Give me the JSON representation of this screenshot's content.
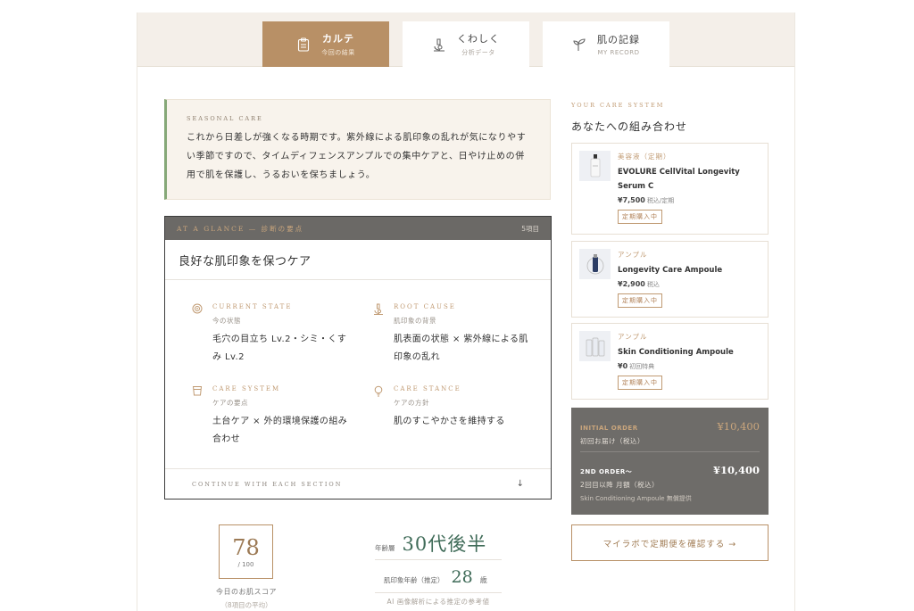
{
  "tabs": [
    {
      "main": "カルテ",
      "sub": "今回の結果",
      "icon": "clipboard-icon"
    },
    {
      "main": "くわしく",
      "sub": "分析データ",
      "icon": "microscope-icon"
    },
    {
      "main": "肌の記録",
      "sub": "MY RECORD",
      "icon": "sprout-icon"
    }
  ],
  "seasonal": {
    "label": "SEASONAL CARE",
    "body": "これから日差しが強くなる時期です。紫外線による肌印象の乱れが気になりやすい季節ですので、タイムディフェンスアンプルでの集中ケアと、日やけ止めの併用で肌を保護し、うるおいを保ちましょう。"
  },
  "glance": {
    "header": "AT A GLANCE — 診断の要点",
    "count": "5項目",
    "title": "良好な肌印象を保つケア",
    "cells": [
      {
        "head": "CURRENT STATE",
        "sub": "今の状態",
        "body": "毛穴の目立ち Lv.2・シミ・くすみ Lv.2",
        "icon": "target-icon"
      },
      {
        "head": "ROOT CAUSE",
        "sub": "肌印象の背景",
        "body": "肌表面の状態 × 紫外線による肌印象の乱れ",
        "icon": "microscope-icon"
      },
      {
        "head": "CARE SYSTEM",
        "sub": "ケアの要点",
        "body": "土台ケア × 外的環境保護の組み合わせ",
        "icon": "cup-icon"
      },
      {
        "head": "CARE STANCE",
        "sub": "ケアの方針",
        "body": "肌のすこやかさを維持する",
        "icon": "bulb-icon"
      }
    ],
    "footer": "CONTINUE WITH EACH SECTION",
    "footer_arrow": "↓"
  },
  "score": {
    "value": "78",
    "denominator": "/ 100",
    "label": "今日のお肌スコア",
    "note": "（8項目の平均）"
  },
  "age": {
    "label": "年齢層",
    "value": "30代後半",
    "est_label": "肌印象年齢（推定）",
    "est_value": "28",
    "est_unit": "歳",
    "note": "AI 画像解析による推定の参考値"
  },
  "care_system": {
    "label": "YOUR CARE SYSTEM",
    "title": "あなたへの組み合わせ",
    "products": [
      {
        "category": "美容液（定期）",
        "name": "EVOLURE CellVital Longevity Serum C",
        "price": "¥7,500",
        "tax": "税込/定期",
        "badge": "定期購入中"
      },
      {
        "category": "アンプル",
        "name": "Longevity Care Ampoule",
        "price": "¥2,900",
        "tax": "税込",
        "badge": "定期購入中"
      },
      {
        "category": "アンプル",
        "name": "Skin Conditioning Ampoule",
        "price": "¥0",
        "tax": "初回特典",
        "badge": "定期購入中"
      }
    ]
  },
  "orders": {
    "initial_label": "INITIAL ORDER",
    "initial_price": "¥10,400",
    "initial_sub": "初回お届け（税込）",
    "second_label": "2ND ORDER〜",
    "second_price": "¥10,400",
    "second_sub": "2回目以降 月額（税込）",
    "second_note": "Skin Conditioning Ampoule 無償提供"
  },
  "cta": {
    "label": "マイラボで定期便を確認する →"
  },
  "colors": {
    "accent": "#b89066",
    "green": "#3f6b58",
    "dark": "#6e6c69",
    "seasonal_border": "#86a878"
  }
}
